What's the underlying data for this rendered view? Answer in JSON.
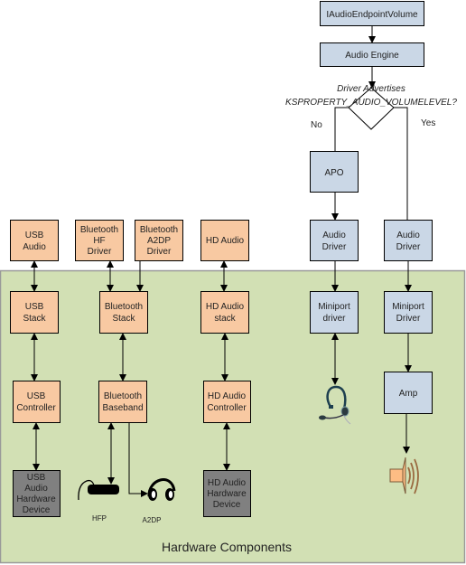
{
  "colors": {
    "hardware_region": "#d2e0b4",
    "hardware_region_border": "#999999",
    "driver_box": "#f8c9a2",
    "system_box": "#cad7e6",
    "device_box": "#808080",
    "line": "#000000",
    "speaker": "#fdbd84"
  },
  "hardware_region": {
    "label": "Hardware Components"
  },
  "boxes": {
    "iaudio_endpoint_volume": "IAudioEndpointVolume",
    "audio_engine": "Audio Engine",
    "apo": "APO",
    "audio_driver_left": [
      "Audio",
      "Driver"
    ],
    "audio_driver_right": [
      "Audio",
      "Driver"
    ],
    "miniport_left": [
      "Miniport",
      "driver"
    ],
    "miniport_right": [
      "Miniport",
      "Driver"
    ],
    "amp": "Amp",
    "usb_audio": [
      "USB",
      "Audio"
    ],
    "bt_hf_driver": [
      "Bluetooth",
      "HF",
      "Driver"
    ],
    "bt_a2dp_driver": [
      "Bluetooth",
      "A2DP",
      "Driver"
    ],
    "hd_audio": "HD Audio",
    "usb_stack": [
      "USB",
      "Stack"
    ],
    "bt_stack": [
      "Bluetooth",
      "Stack"
    ],
    "hd_audio_stack": [
      "HD Audio",
      "stack"
    ],
    "usb_controller": [
      "USB",
      "Controller"
    ],
    "bt_baseband": [
      "Bluetooth",
      "Baseband"
    ],
    "hd_audio_controller": [
      "HD Audio",
      "Controller"
    ],
    "usb_hw_device": [
      "USB",
      "Audio",
      "Hardware",
      "Device"
    ],
    "hd_hw_device": [
      "HD Audio",
      "Hardware",
      "Device"
    ]
  },
  "decision": {
    "line1": "Driver Advertises",
    "line2": "KSPROPERTY_AUDIO_VOLUMELEVEL?",
    "no_label": "No",
    "yes_label": "Yes"
  },
  "devices": {
    "hfp_label": "HFP",
    "a2dp_label": "A2DP",
    "icons": [
      "hfp-earpiece-icon",
      "headphones-icon",
      "headset-icon",
      "speaker-icon"
    ]
  }
}
